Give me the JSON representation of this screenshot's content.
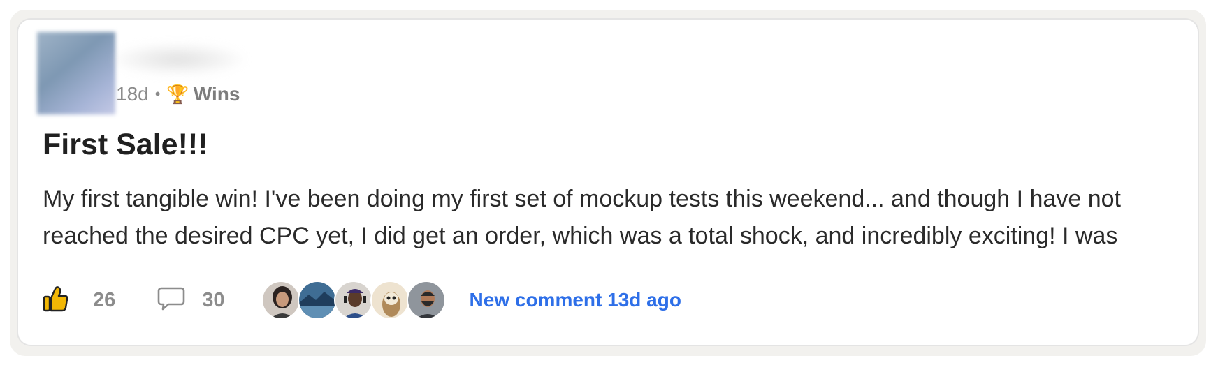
{
  "post": {
    "age": "18d",
    "separator": "•",
    "category_emoji": "🏆",
    "category": "Wins",
    "title": "First Sale!!!",
    "body": "My first tangible win! I've been doing my first set of mockup tests this weekend... and though I have not reached the desired CPC yet, I did get an order, which was a total shock, and incredibly exciting! I was"
  },
  "actions": {
    "like_count": "26",
    "comment_count": "30",
    "like_icon": "thumbs-up-icon",
    "comment_icon": "comment-bubble-icon",
    "new_comment_label": "New comment 13d ago"
  },
  "commenter_avatars": [
    {
      "name": "commenter-avatar-1"
    },
    {
      "name": "commenter-avatar-2"
    },
    {
      "name": "commenter-avatar-3"
    },
    {
      "name": "commenter-avatar-4"
    },
    {
      "name": "commenter-avatar-5"
    }
  ],
  "colors": {
    "link": "#2e6fe8",
    "muted": "#8c8c8c",
    "like_icon": "#f2b705"
  }
}
